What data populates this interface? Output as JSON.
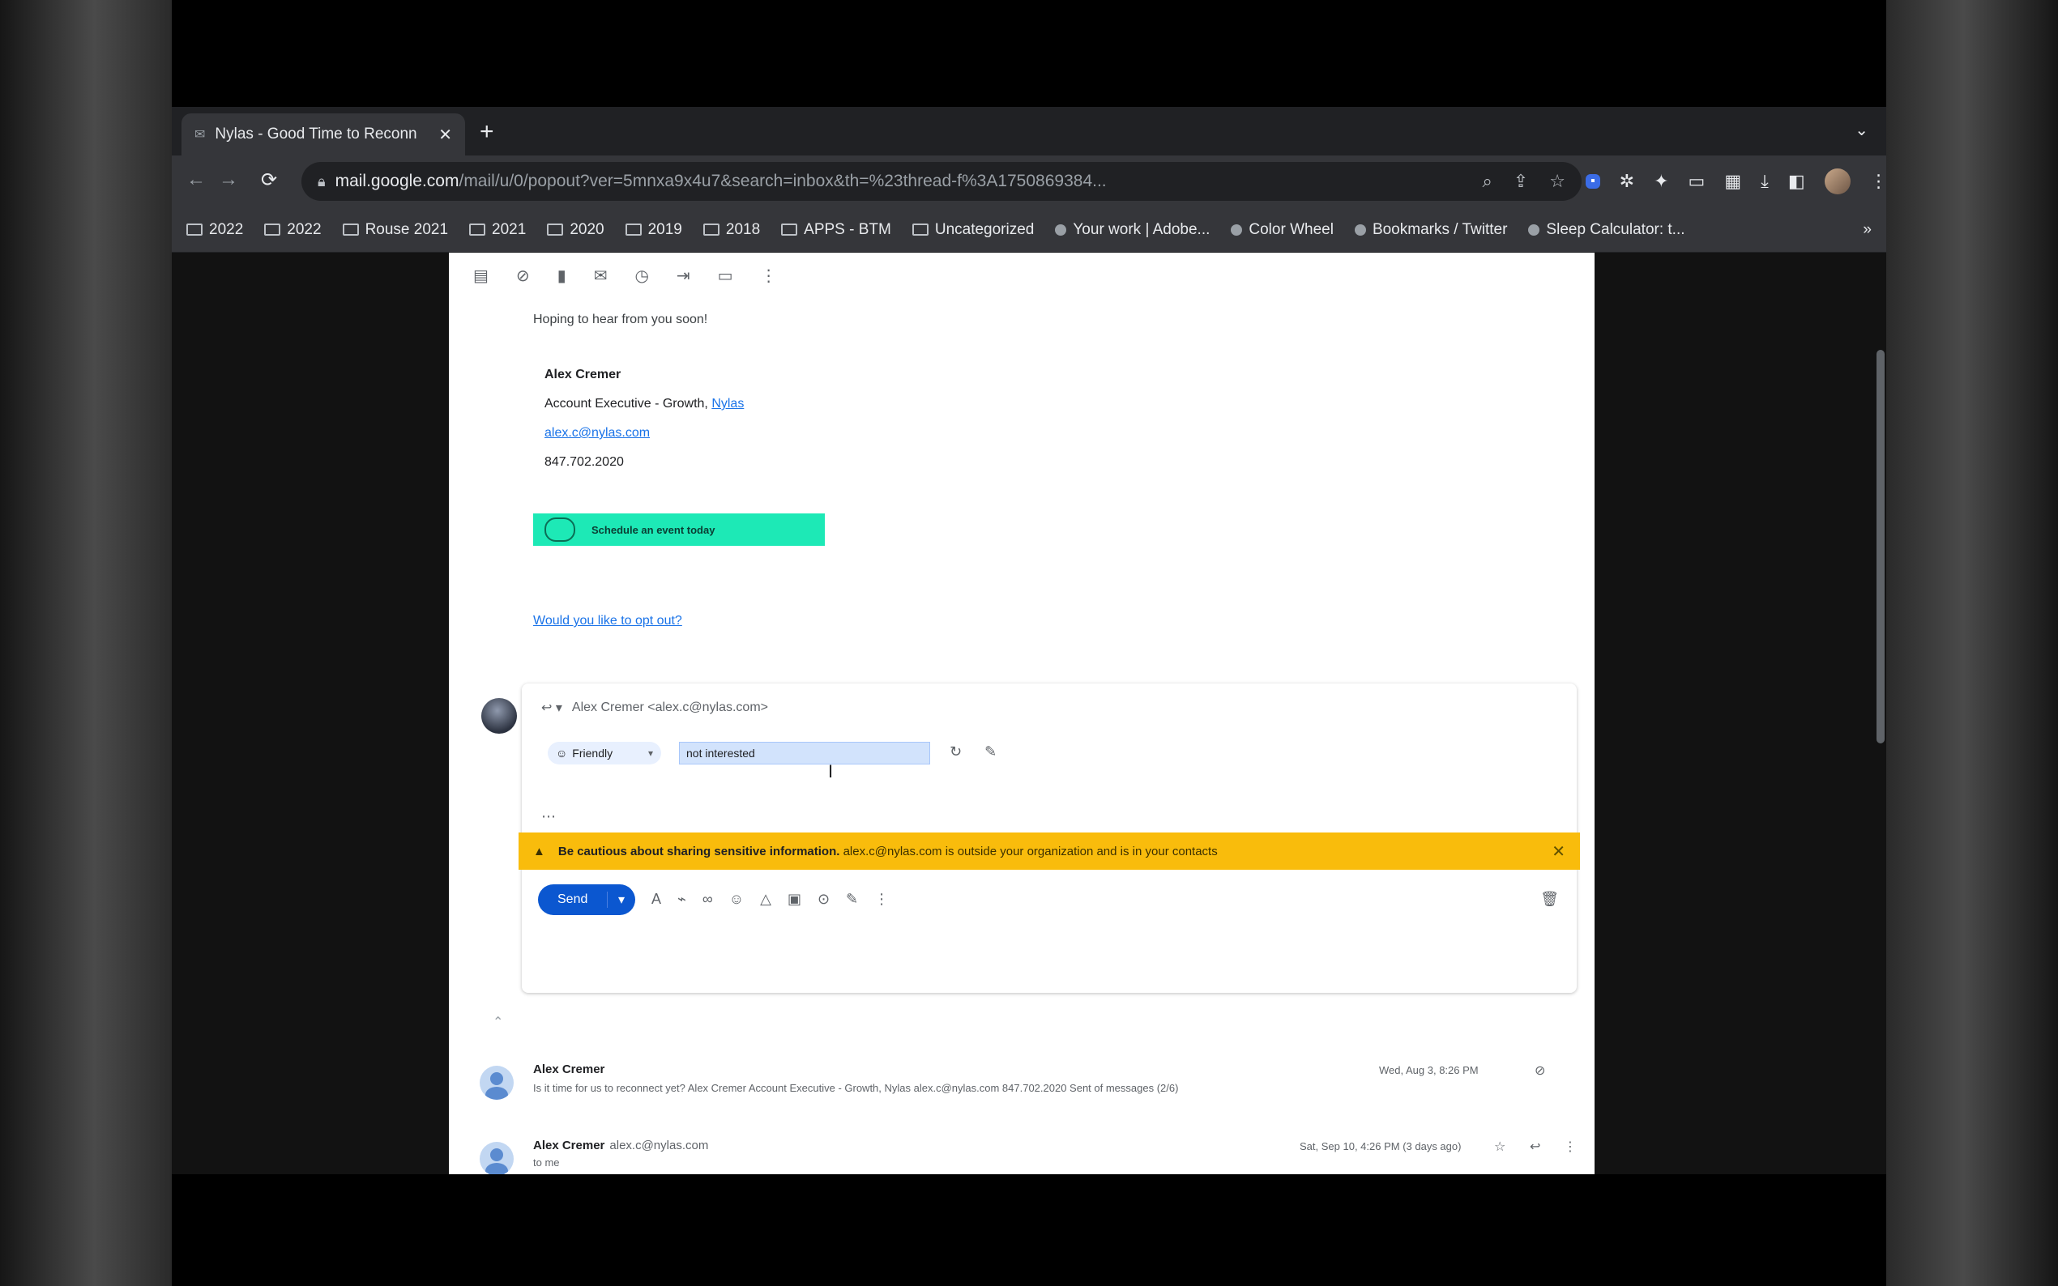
{
  "browser": {
    "tab_title": "Nylas - Good Time to Reconn",
    "tab_favicon": "mail-icon",
    "url_host": "mail.google.com",
    "url_path": "/mail/u/0/popout?ver=5mnxa9x4u7&search=inbox&th=%23thread-f%3A1750869384...",
    "bookmarks": [
      {
        "label": "2022",
        "icon": "folder"
      },
      {
        "label": "2022",
        "icon": "folder"
      },
      {
        "label": "Rouse 2021",
        "icon": "folder"
      },
      {
        "label": "2021",
        "icon": "folder"
      },
      {
        "label": "2020",
        "icon": "folder"
      },
      {
        "label": "2019",
        "icon": "folder"
      },
      {
        "label": "2018",
        "icon": "folder"
      },
      {
        "label": "APPS - BTM",
        "icon": "folder"
      },
      {
        "label": "Uncategorized",
        "icon": "folder"
      },
      {
        "label": "Your work | Adobe...",
        "icon": "site"
      },
      {
        "label": "Color Wheel",
        "icon": "site"
      },
      {
        "label": "Bookmarks / Twitter",
        "icon": "site"
      },
      {
        "label": "Sleep Calculator: t...",
        "icon": "site"
      }
    ]
  },
  "email": {
    "closing": "Hoping to hear from you soon!",
    "sig_name": "Alex Cremer",
    "sig_title": "Account Executive - Growth,",
    "sig_company": "Nylas",
    "sig_email": "alex.c@nylas.com",
    "sig_phone": "847.702.2020",
    "banner_text": "Schedule an event today",
    "unsubscribe": "Would you like to opt out?"
  },
  "reply": {
    "to": "Alex Cremer <alex.c@nylas.com>",
    "tone_label": "Friendly",
    "ai_input_value": "not interested",
    "warning_bold": "Be cautious about sharing sensitive information.",
    "warning_rest": "alex.c@nylas.com is outside your organization and is in your contacts",
    "send_label": "Send"
  },
  "thread": [
    {
      "from": "Alex Cremer",
      "email": "",
      "snippet": "Is it time for us to reconnect yet? Alex Cremer Account Executive - Growth, Nylas alex.c@nylas.com 847.702.2020 Sent of messages (2/6)",
      "date": "Wed, Aug 3, 8:26 PM"
    },
    {
      "from": "Alex Cremer",
      "email": "alex.c@nylas.com",
      "snippet": "to me",
      "date": "Sat, Sep 10, 4:26 PM (3 days ago)"
    }
  ]
}
